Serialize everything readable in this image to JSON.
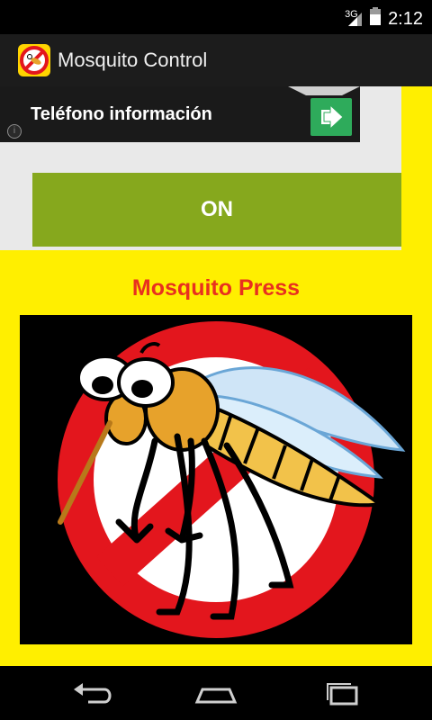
{
  "status_bar": {
    "network": "3G",
    "time": "2:12"
  },
  "app": {
    "title": "Mosquito Control",
    "icon": "no-mosquito-icon"
  },
  "ad": {
    "text": "Teléfono información",
    "info": "i",
    "action_icon": "arrow-right-icon",
    "accent": "#2eab5b"
  },
  "main": {
    "toggle_label": "ON",
    "press_label": "Mosquito Press",
    "image": "no-mosquito-sign"
  },
  "colors": {
    "background": "#ffef00",
    "toggle": "#86a81d",
    "press_text": "#e8301f",
    "sign_red": "#e3161d"
  },
  "nav": {
    "back": "back-icon",
    "home": "home-icon",
    "recents": "recents-icon"
  }
}
